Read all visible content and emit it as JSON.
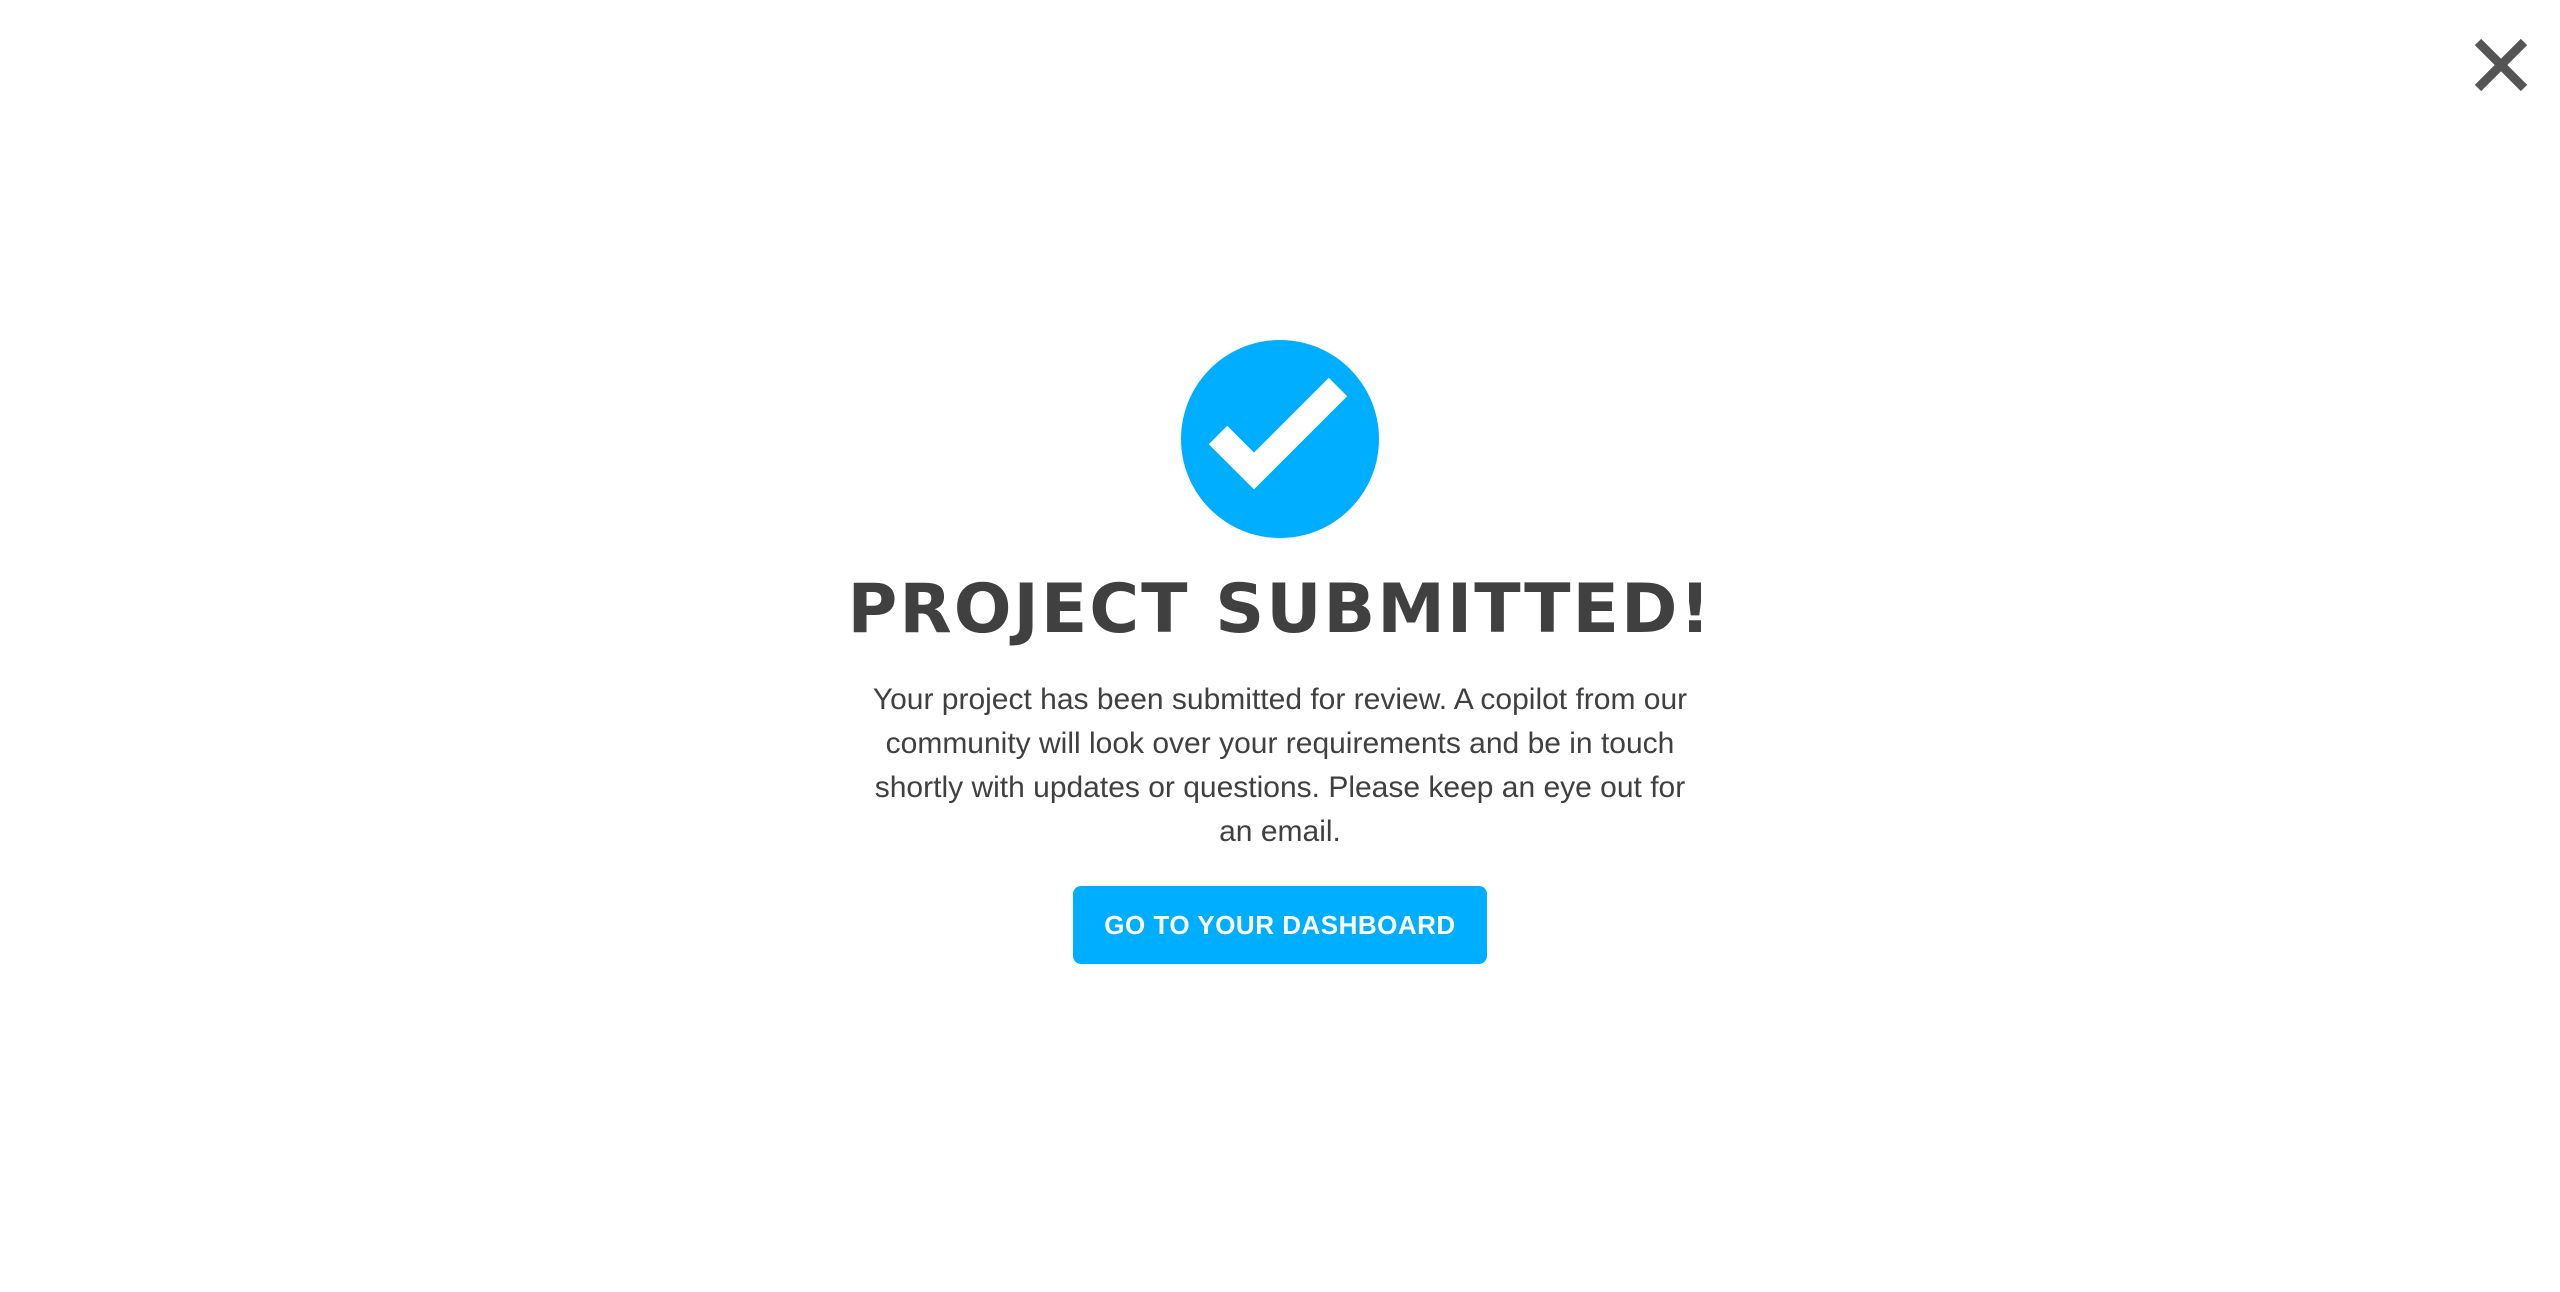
{
  "colors": {
    "accent": "#00aeff",
    "text": "#404040",
    "close_icon": "#555555",
    "background": "#ffffff"
  },
  "icons": {
    "close": "close-icon",
    "success": "checkmark-circle-icon"
  },
  "modal": {
    "title": "PROJECT SUBMITTED!",
    "message": "Your project has been submitted for review. A copilot from our community will look over your requirements and be in touch shortly with updates or questions. Please keep an eye out for an email.",
    "dashboard_button_label": "GO TO YOUR DASHBOARD"
  }
}
